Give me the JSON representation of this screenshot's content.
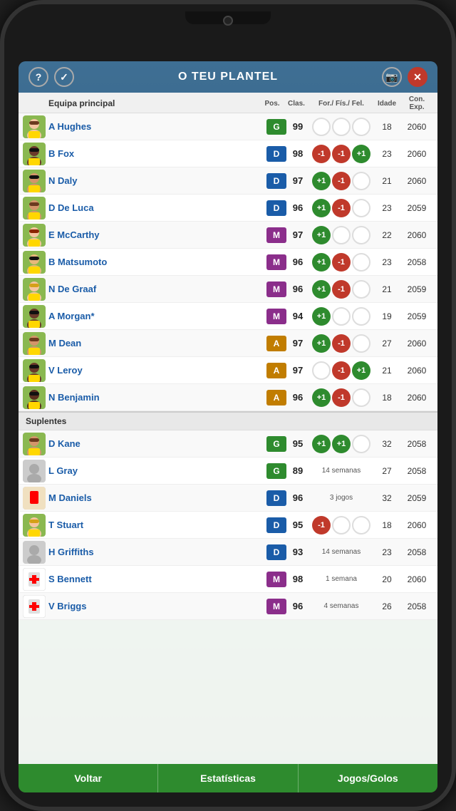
{
  "header": {
    "title": "O TEU PLANTEL",
    "help_icon": "?",
    "check_icon": "✓",
    "camera_icon": "📷",
    "close_icon": "✕"
  },
  "columns": {
    "name": "Equipa principal",
    "pos": "Pos.",
    "clas": "Clas.",
    "for_fis_fel": "For./ Fís./ Fel.",
    "idade": "Idade",
    "con_exp": "Con. Exp."
  },
  "main_team": [
    {
      "name": "A Hughes",
      "pos": "G",
      "pos_class": "pos-g",
      "clas": 99,
      "stats": [
        "empty",
        "empty",
        "empty"
      ],
      "idade": 18,
      "exp": 2060,
      "skin": "light",
      "hair": "brown"
    },
    {
      "name": "B Fox",
      "pos": "D",
      "pos_class": "pos-d",
      "clas": 98,
      "stats": [
        "red-1",
        "red-1",
        "green+1"
      ],
      "idade": 23,
      "exp": 2060,
      "skin": "dark",
      "hair": "black"
    },
    {
      "name": "N Daly",
      "pos": "D",
      "pos_class": "pos-d",
      "clas": 97,
      "stats": [
        "green+1",
        "red-1",
        "empty"
      ],
      "idade": 21,
      "exp": 2060,
      "skin": "medium",
      "hair": "black"
    },
    {
      "name": "D De Luca",
      "pos": "D",
      "pos_class": "pos-d",
      "clas": 96,
      "stats": [
        "green+1",
        "red-1",
        "empty"
      ],
      "idade": 23,
      "exp": 2059,
      "skin": "medium",
      "hair": "brown"
    },
    {
      "name": "E McCarthy",
      "pos": "M",
      "pos_class": "pos-m",
      "clas": 97,
      "stats": [
        "green+1",
        "empty",
        "empty"
      ],
      "idade": 22,
      "exp": 2060,
      "skin": "light",
      "hair": "red"
    },
    {
      "name": "B Matsumoto",
      "pos": "M",
      "pos_class": "pos-m",
      "clas": 96,
      "stats": [
        "green+1",
        "red-1",
        "empty"
      ],
      "idade": 23,
      "exp": 2058,
      "skin": "asian",
      "hair": "black"
    },
    {
      "name": "N De Graaf",
      "pos": "M",
      "pos_class": "pos-m",
      "clas": 96,
      "stats": [
        "green+1",
        "red-1",
        "empty"
      ],
      "idade": 21,
      "exp": 2059,
      "skin": "light",
      "hair": "blonde"
    },
    {
      "name": "A Morgan*",
      "pos": "M",
      "pos_class": "pos-m",
      "clas": 94,
      "stats": [
        "green+1",
        "empty",
        "empty"
      ],
      "idade": 19,
      "exp": 2059,
      "skin": "dark",
      "hair": "black"
    },
    {
      "name": "M Dean",
      "pos": "A",
      "pos_class": "pos-a",
      "clas": 97,
      "stats": [
        "green+1",
        "red-1",
        "empty"
      ],
      "idade": 27,
      "exp": 2060,
      "skin": "medium",
      "hair": "brown"
    },
    {
      "name": "V Leroy",
      "pos": "A",
      "pos_class": "pos-a",
      "clas": 97,
      "stats": [
        "empty",
        "red-1",
        "green+1"
      ],
      "idade": 21,
      "exp": 2060,
      "skin": "dark",
      "hair": "black"
    },
    {
      "name": "N Benjamin",
      "pos": "A",
      "pos_class": "pos-a",
      "clas": 96,
      "stats": [
        "green+1",
        "red-1",
        "empty"
      ],
      "idade": 18,
      "exp": 2060,
      "skin": "dark2",
      "hair": "black"
    }
  ],
  "subs_label": "Suplentes",
  "subs": [
    {
      "name": "D Kane",
      "pos": "G",
      "pos_class": "pos-g",
      "clas": 95,
      "stats": [
        "green+1",
        "green+1",
        "empty"
      ],
      "idade": 32,
      "exp": 2058,
      "skin": "medium",
      "hair": "brown",
      "type": "normal"
    },
    {
      "name": "L Gray",
      "pos": "G",
      "pos_class": "pos-g",
      "clas": 89,
      "stats_text": "14 semanas",
      "idade": 27,
      "exp": 2058,
      "skin": "gray",
      "type": "injured"
    },
    {
      "name": "M Daniels",
      "pos": "D",
      "pos_class": "pos-d",
      "clas": 96,
      "stats_text": "3 jogos",
      "idade": 32,
      "exp": 2059,
      "skin": "card",
      "type": "card"
    },
    {
      "name": "T Stuart",
      "pos": "D",
      "pos_class": "pos-d",
      "clas": 95,
      "stats": [
        "red-1",
        "empty",
        "empty"
      ],
      "idade": 18,
      "exp": 2060,
      "skin": "light",
      "hair": "blonde",
      "type": "normal"
    },
    {
      "name": "H Griffiths",
      "pos": "D",
      "pos_class": "pos-d",
      "clas": 93,
      "stats_text": "14 semanas",
      "idade": 23,
      "exp": 2058,
      "skin": "gray",
      "type": "injured"
    },
    {
      "name": "S Bennett",
      "pos": "M",
      "pos_class": "pos-m",
      "clas": 98,
      "stats_text": "1 semana",
      "idade": 20,
      "exp": 2060,
      "skin": "medical",
      "type": "medical"
    },
    {
      "name": "V Briggs",
      "pos": "M",
      "pos_class": "pos-m",
      "clas": 96,
      "stats_text": "4 semanas",
      "idade": 26,
      "exp": 2058,
      "skin": "medical",
      "type": "medical"
    }
  ],
  "buttons": {
    "back": "Voltar",
    "stats": "Estatísticas",
    "goals": "Jogos/Golos"
  }
}
